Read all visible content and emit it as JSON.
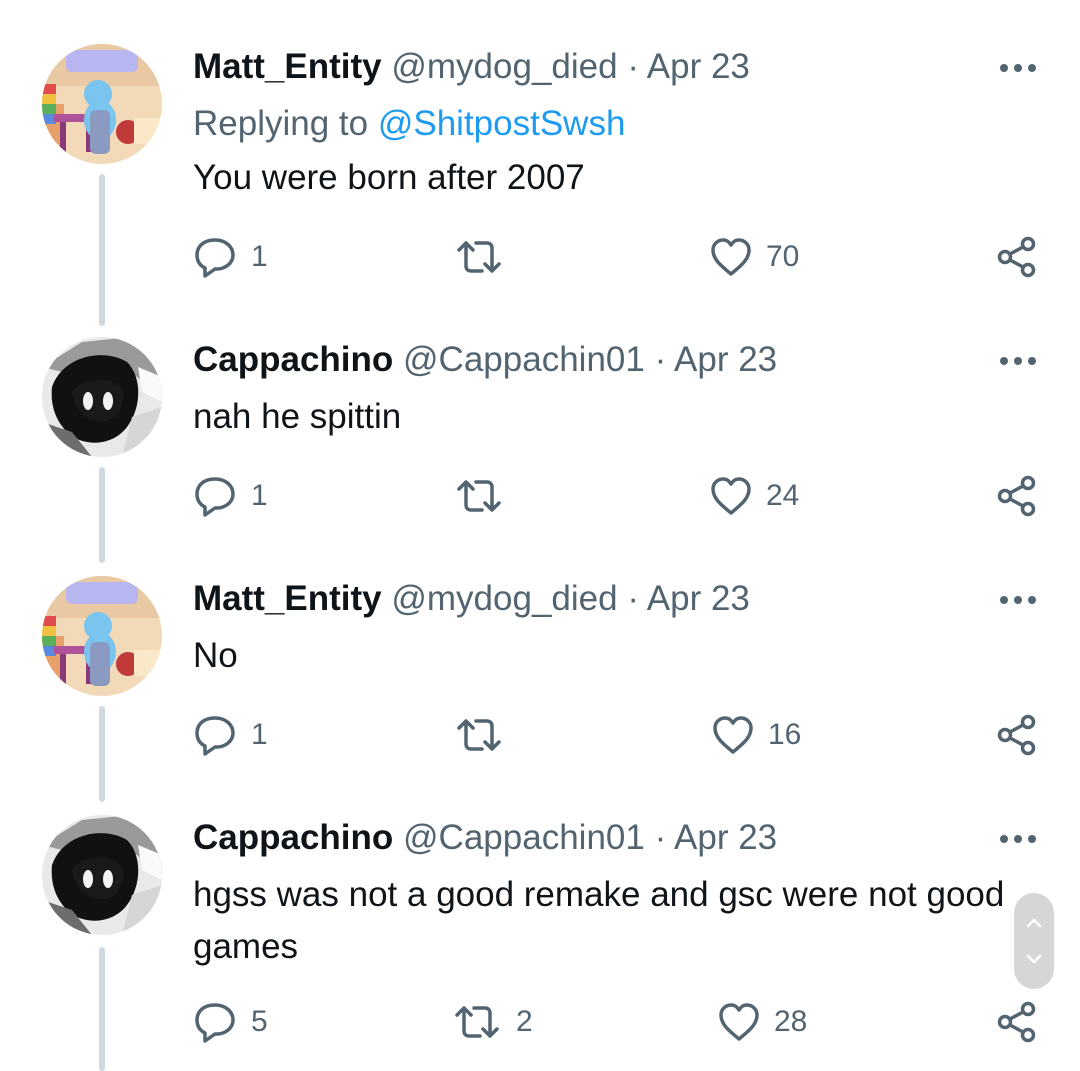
{
  "tweets": [
    {
      "name": "Matt_Entity",
      "handle": "@mydog_died",
      "separator": "·",
      "date": "Apr 23",
      "replying_label": "Replying to",
      "replying_mention": "@ShitpostSwsh",
      "text": "You were born after 2007",
      "replies": "1",
      "retweets": "",
      "likes": "70"
    },
    {
      "name": "Cappachino",
      "handle": "@Cappachin01",
      "separator": "·",
      "date": "Apr 23",
      "text": "nah he spittin",
      "replies": "1",
      "retweets": "",
      "likes": "24"
    },
    {
      "name": "Matt_Entity",
      "handle": "@mydog_died",
      "separator": "·",
      "date": "Apr 23",
      "text": "No",
      "replies": "1",
      "retweets": "",
      "likes": "16"
    },
    {
      "name": "Cappachino",
      "handle": "@Cappachin01",
      "separator": "·",
      "date": "Apr 23",
      "text_line1": "hgss was not a good remake and gsc were not good",
      "text_line2": "games",
      "replies": "5",
      "retweets": "2",
      "likes": "28"
    }
  ],
  "icons": {
    "reply": "reply-icon",
    "retweet": "retweet-icon",
    "like": "heart-icon",
    "share": "share-icon",
    "more": "more-dots-icon"
  },
  "colors": {
    "text": "#0f1419",
    "secondary": "#536471",
    "link": "#1d9bf0",
    "thread_line": "#cfd9de"
  }
}
